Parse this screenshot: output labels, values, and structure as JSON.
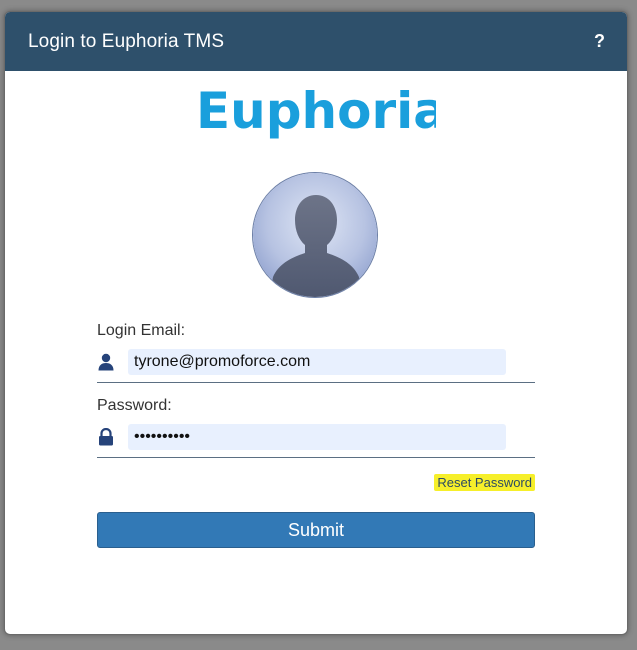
{
  "dialog": {
    "title": "Login to Euphoria TMS",
    "help_label": "?"
  },
  "logo": {
    "text": "Euphoria",
    "color": "#1a9fdc"
  },
  "avatar": {
    "icon": "user-silhouette-icon"
  },
  "form": {
    "email_label": "Login Email:",
    "email_value": "tyrone@promoforce.com",
    "email_icon": "user-icon",
    "password_label": "Password:",
    "password_value": "••••••••••",
    "password_icon": "lock-icon",
    "reset_label": "Reset Password",
    "submit_label": "Submit"
  },
  "colors": {
    "titlebar": "#2e506b",
    "accent": "#3279b6",
    "highlight": "#f6ef2a"
  }
}
